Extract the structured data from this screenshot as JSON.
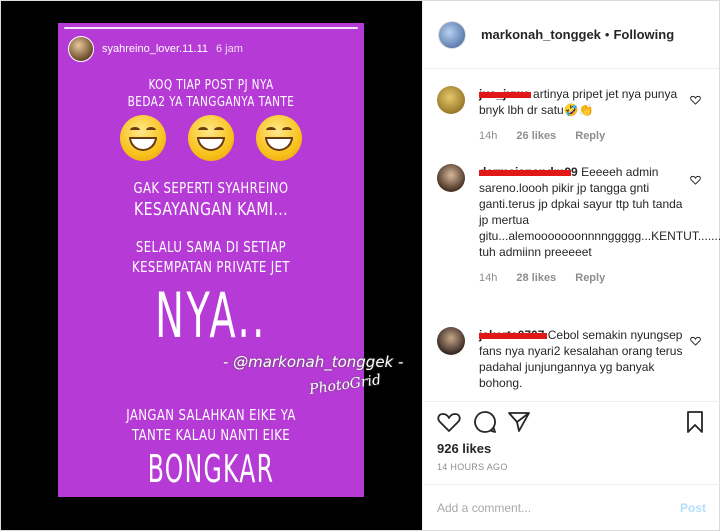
{
  "story": {
    "username": "syahreino_lover.11.11",
    "time": "6 jam",
    "lines_top": [
      "KOQ TIAP POST PJ NYA",
      "BEDA2 YA TANGGANYA TANTE"
    ],
    "lines_mid1": [
      "GAK SEPERTI SYAHREINO",
      "KESAYANGAN KAMI..."
    ],
    "lines_mid2": [
      "SELALU SAMA DI SETIAP",
      "KESEMPATAN PRIVATE JET"
    ],
    "big_word": "NYA..",
    "lines_bottom": [
      "JANGAN SALAHKAN EIKE YA",
      "TANTE KALAU NANTI EIKE"
    ],
    "bottom_word": "BONGKAR",
    "emoji_icon": "grinning-face-icon",
    "background": "#b63ad6"
  },
  "watermark": {
    "handle": "- @markonah_tonggek -",
    "brand": "PhotoGrid"
  },
  "header": {
    "username": "markonah_tonggek",
    "separator": "•",
    "follow_status": "Following"
  },
  "comments": [
    {
      "username": "jua_juwe",
      "text": "artinya pripet jet nya punya bnyk lbh dr satu🤣👏",
      "time": "14h",
      "likes": "26 likes",
      "reply": "Reply"
    },
    {
      "username": "darmaisnandm99",
      "text": "Eeeeeh admin sareno.loooh pikir jp tangga gnti ganti.terus jp dpkai sayur ttp tuh tanda jp mertua gitu...alemooooooonnnnggggg...KENTUT.......bner tuh admiinn preeeeet",
      "time": "14h",
      "likes": "28 likes",
      "reply": "Reply"
    },
    {
      "username": "jakerta0707",
      "text": "Cebol semakin nyungsep fans nya nyari2 kesalahan orang terus padahal junjungannya yg banyak bohong.",
      "time": "",
      "likes": "",
      "reply": ""
    }
  ],
  "post": {
    "likes": "926 likes",
    "time": "14 HOURS AGO"
  },
  "compose": {
    "placeholder": "Add a comment...",
    "post_label": "Post"
  },
  "colors": {
    "accent": "#3897f0",
    "post_disabled": "#b2dffc",
    "redaction": "#e01818"
  }
}
